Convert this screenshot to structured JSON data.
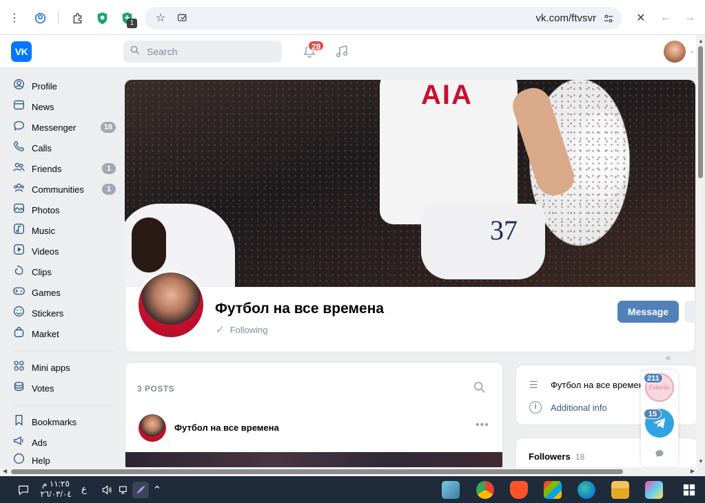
{
  "browser": {
    "url": "vk.com/ftvsvr",
    "extension_badge": "1"
  },
  "header": {
    "logo": "VK",
    "search_placeholder": "Search",
    "notifications_count": "28"
  },
  "sidebar": {
    "items": [
      {
        "label": "Profile",
        "icon": "user-circle-icon",
        "count": ""
      },
      {
        "label": "News",
        "icon": "news-icon",
        "count": ""
      },
      {
        "label": "Messenger",
        "icon": "chat-icon",
        "count": "18"
      },
      {
        "label": "Calls",
        "icon": "phone-icon",
        "count": ""
      },
      {
        "label": "Friends",
        "icon": "friends-icon",
        "count": "1"
      },
      {
        "label": "Communities",
        "icon": "communities-icon",
        "count": "1"
      },
      {
        "label": "Photos",
        "icon": "photo-icon",
        "count": ""
      },
      {
        "label": "Music",
        "icon": "music-icon",
        "count": ""
      },
      {
        "label": "Videos",
        "icon": "video-icon",
        "count": ""
      },
      {
        "label": "Clips",
        "icon": "clips-icon",
        "count": ""
      },
      {
        "label": "Games",
        "icon": "gamepad-icon",
        "count": ""
      },
      {
        "label": "Stickers",
        "icon": "sticker-icon",
        "count": ""
      },
      {
        "label": "Market",
        "icon": "bag-icon",
        "count": ""
      }
    ],
    "items2": [
      {
        "label": "Mini apps",
        "icon": "apps-icon"
      },
      {
        "label": "Votes",
        "icon": "coins-icon"
      }
    ],
    "items3": [
      {
        "label": "Bookmarks",
        "icon": "bookmark-icon"
      },
      {
        "label": "Ads",
        "icon": "megaphone-icon"
      },
      {
        "label": "Help",
        "icon": "help-icon"
      }
    ]
  },
  "cover": {
    "sponsor_text": "AIA",
    "shirt_number": "37"
  },
  "profile": {
    "name": "Футбол на все времена",
    "status": "Following",
    "message_button": "Message"
  },
  "posts": {
    "title": "3 POSTS",
    "first_post_author": "Футбол на все времена"
  },
  "info": {
    "description": "Футбол на все времена",
    "additional": "Additional info"
  },
  "followers": {
    "label": "Followers",
    "count": "18"
  },
  "chat_widget": {
    "first_count": "211",
    "first_label": "Faberlic",
    "second_count": "15"
  },
  "taskbar": {
    "time": "١١:٢٥ م",
    "date": "٢٦/٠٣/٠٤",
    "lang": "ع"
  },
  "colors": {
    "vk_blue": "#0077ff",
    "button_blue": "#5181b8",
    "badge_red": "#e64646",
    "link_blue": "#2a5885"
  }
}
